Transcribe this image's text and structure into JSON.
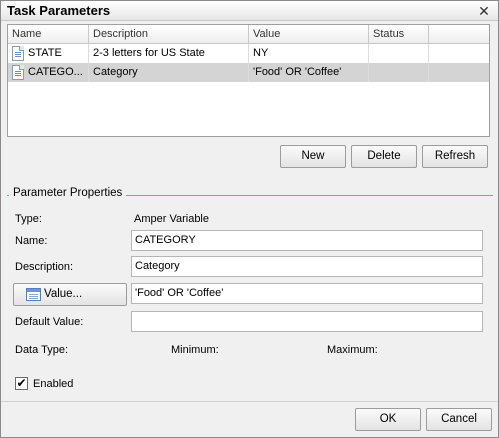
{
  "dialog": {
    "title": "Task Parameters",
    "close_glyph": "✕"
  },
  "table": {
    "columns": [
      "Name",
      "Description",
      "Value",
      "Status"
    ],
    "rows": [
      {
        "name": "STATE",
        "description": "2-3 letters for US State",
        "value": "NY",
        "status": "",
        "selected": false
      },
      {
        "name": "CATEGO...",
        "description": "Category",
        "value": "'Food' OR 'Coffee'",
        "status": "",
        "selected": true
      }
    ],
    "row_icon": "document-icon"
  },
  "table_buttons": {
    "new_label": "New",
    "delete_label": "Delete",
    "refresh_label": "Refresh"
  },
  "properties": {
    "group_title": "Parameter Properties",
    "type_label": "Type:",
    "type_value": "Amper Variable",
    "name_label": "Name:",
    "name_value": "CATEGORY",
    "description_label": "Description:",
    "description_value": "Category",
    "value_button_label": "Value...",
    "value_button_icon": "table-icon",
    "value_value": "'Food' OR 'Coffee'",
    "default_value_label": "Default Value:",
    "default_value_value": "",
    "data_type_label": "Data Type:",
    "minimum_label": "Minimum:",
    "maximum_label": "Maximum:",
    "enabled_label": "Enabled",
    "enabled_checked": true,
    "check_glyph": "✔"
  },
  "footer": {
    "ok_label": "OK",
    "cancel_label": "Cancel"
  }
}
